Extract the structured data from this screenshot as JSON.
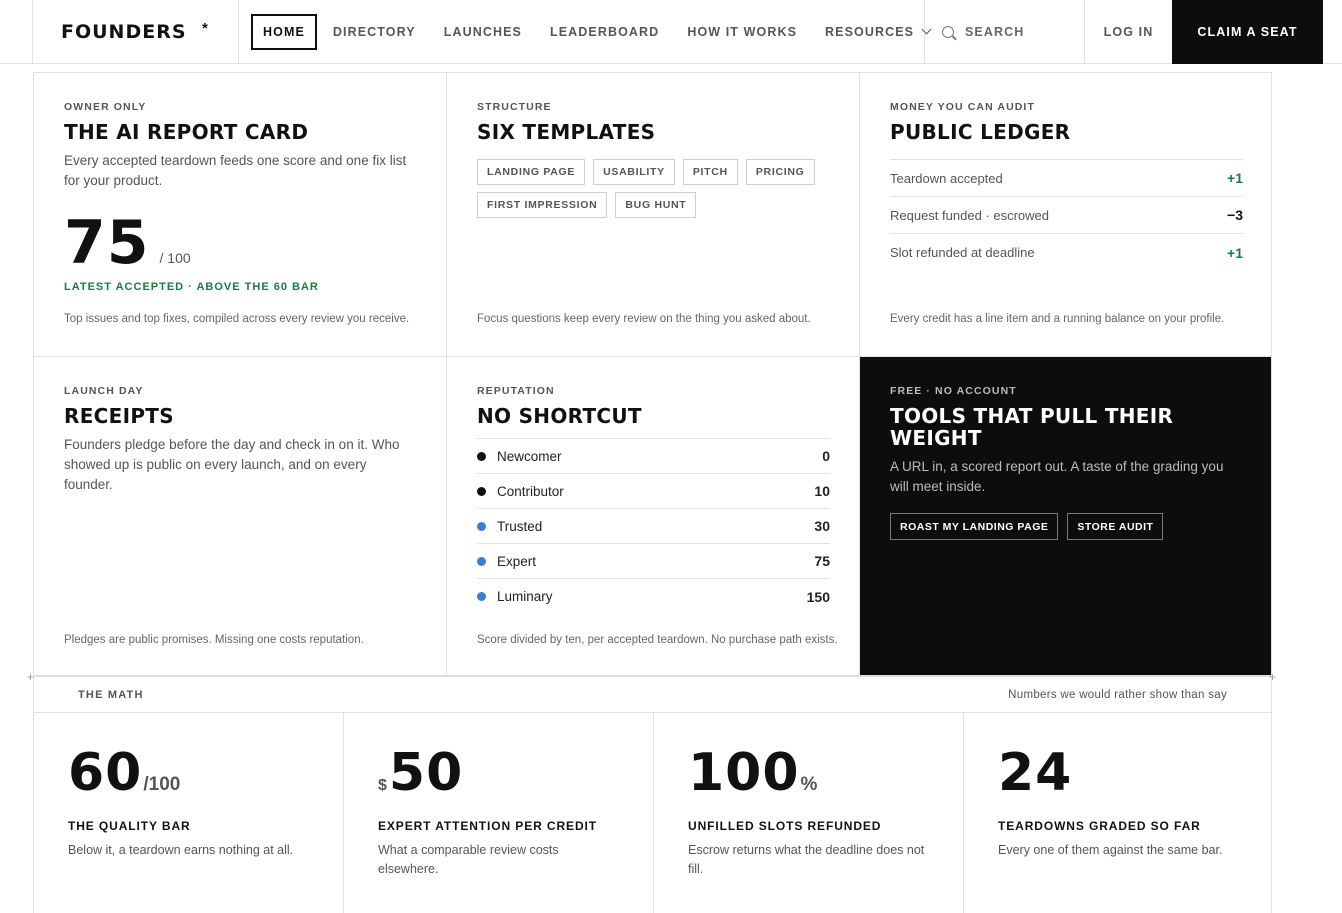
{
  "nav": {
    "logo": "FOUNDERS",
    "logo_mark": "*",
    "links": [
      "HOME",
      "DIRECTORY",
      "LAUNCHES",
      "LEADERBOARD",
      "HOW IT WORKS",
      "RESOURCES"
    ],
    "search": "SEARCH",
    "login": "LOG IN",
    "cta": "CLAIM A SEAT"
  },
  "report_card": {
    "eyebrow": "OWNER ONLY",
    "title": "THE AI REPORT CARD",
    "desc": "Every accepted teardown feeds one score and one fix list for your product.",
    "score": "75",
    "denominator": "/ 100",
    "status": "LATEST ACCEPTED · ABOVE THE 60 BAR",
    "foot": "Top issues and top fixes, compiled across every review you receive."
  },
  "templates": {
    "eyebrow": "STRUCTURE",
    "title": "SIX TEMPLATES",
    "tags": [
      "LANDING PAGE",
      "USABILITY",
      "PITCH",
      "PRICING",
      "FIRST IMPRESSION",
      "BUG HUNT"
    ],
    "foot": "Focus questions keep every review on the thing you asked about."
  },
  "ledger": {
    "eyebrow": "MONEY YOU CAN AUDIT",
    "title": "PUBLIC LEDGER",
    "rows": [
      {
        "label": "Teardown accepted",
        "amount": "+1",
        "color": "#1e7a3a"
      },
      {
        "label": "Request funded · escrowed",
        "amount": "−3",
        "color": "#111111"
      },
      {
        "label": "Slot refunded at deadline",
        "amount": "+1",
        "color": "#1e7a3a"
      }
    ],
    "foot": "Every credit has a line item and a running balance on your profile."
  },
  "receipts": {
    "eyebrow": "LAUNCH DAY",
    "title": "RECEIPTS",
    "desc": "Founders pledge before the day and check in on it. Who showed up is public on every launch, and on every founder.",
    "foot": "Pledges are public promises. Missing one costs reputation."
  },
  "reputation": {
    "eyebrow": "REPUTATION",
    "title": "NO SHORTCUT",
    "tiers": [
      {
        "name": "Newcomer",
        "value": "0",
        "color": "#111111"
      },
      {
        "name": "Contributor",
        "value": "10",
        "color": "#111111"
      },
      {
        "name": "Trusted",
        "value": "30",
        "color": "#3b7bd9"
      },
      {
        "name": "Expert",
        "value": "75",
        "color": "#3b7bd9"
      },
      {
        "name": "Luminary",
        "value": "150",
        "color": "#3b7bd9"
      }
    ],
    "foot": "Score divided by ten, per accepted teardown. No purchase path exists."
  },
  "tools": {
    "eyebrow": "FREE · NO ACCOUNT",
    "title": "TOOLS THAT PULL THEIR WEIGHT",
    "desc": "A URL in, a scored report out. A taste of the grading you will meet inside.",
    "buttons": [
      "ROAST MY LANDING PAGE",
      "STORE AUDIT"
    ]
  },
  "math": {
    "label": "THE MATH",
    "note": "Numbers we would rather show than say",
    "stats": [
      {
        "prefix": "",
        "value": "60",
        "suffix": "/100",
        "title": "THE QUALITY BAR",
        "desc": "Below it, a teardown earns nothing at all."
      },
      {
        "prefix": "$",
        "value": "50",
        "suffix": "",
        "title": "EXPERT ATTENTION PER CREDIT",
        "desc": "What a comparable review costs elsewhere."
      },
      {
        "prefix": "",
        "value": "100",
        "suffix": "%",
        "title": "UNFILLED SLOTS REFUNDED",
        "desc": "Escrow returns what the deadline does not fill."
      },
      {
        "prefix": "",
        "value": "24",
        "suffix": "",
        "title": "TEARDOWNS GRADED SO FAR",
        "desc": "Every one of them against the same bar."
      }
    ]
  }
}
